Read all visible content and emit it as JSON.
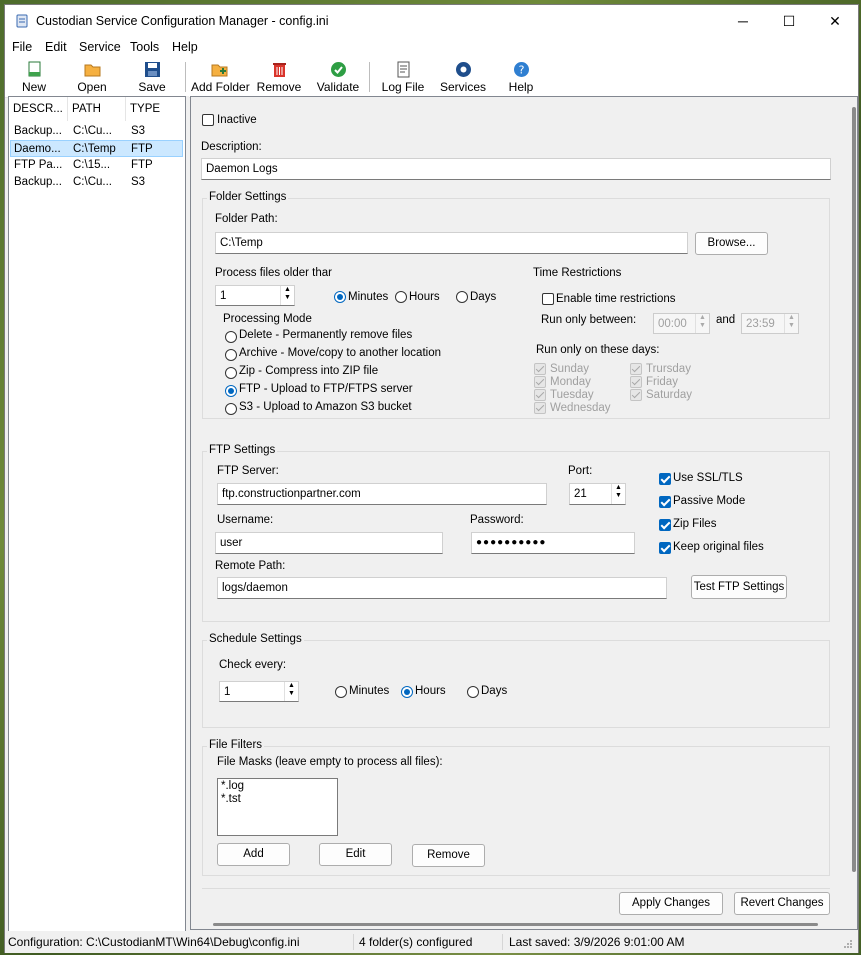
{
  "window": {
    "title": "Custodian Service Configuration Manager - config.ini",
    "minimize": "─",
    "maximize": "☐",
    "close": "✕"
  },
  "menu": [
    "File",
    "Edit",
    "Service",
    "Tools",
    "Help"
  ],
  "toolbar": {
    "new": "New",
    "open": "Open",
    "save": "Save",
    "add_folder": "Add Folder",
    "remove": "Remove",
    "validate": "Validate",
    "log_file": "Log File",
    "services": "Services",
    "help": "Help"
  },
  "folder_list": {
    "columns": [
      "DESCR...",
      "PATH",
      "TYPE"
    ],
    "rows": [
      {
        "desc": "Backup...",
        "path": "C:\\Cu...",
        "type": "S3"
      },
      {
        "desc": "Daemo...",
        "path": "C:\\Temp",
        "type": "FTP"
      },
      {
        "desc": "FTP Pa...",
        "path": "C:\\15...",
        "type": "FTP"
      },
      {
        "desc": "Backup...",
        "path": "C:\\Cu...",
        "type": "S3"
      }
    ]
  },
  "form": {
    "inactive_label": "Inactive",
    "description_label": "Description:",
    "description_value": "Daemon Logs",
    "folder_settings": {
      "title": "Folder Settings",
      "folder_path_label": "Folder Path:",
      "folder_path_value": "C:\\Temp",
      "browse": "Browse...",
      "older_than_label": "Process files older thar",
      "older_than_value": "1",
      "unit_minutes": "Minutes",
      "unit_hours": "Hours",
      "unit_days": "Days",
      "processing_mode_label": "Processing Mode",
      "modes": [
        "Delete - Permanently remove files",
        "Archive - Move/copy to another location",
        "Zip - Compress into ZIP file",
        "FTP - Upload to FTP/FTPS server",
        "S3 - Upload to Amazon S3 bucket"
      ],
      "time_restrictions_label": "Time Restrictions",
      "enable_time_label": "Enable time restrictions",
      "run_between_label": "Run only between:",
      "start_time": "00:00",
      "and_label": "and",
      "end_time": "23:59",
      "run_days_label": "Run only on these days:",
      "days_col1": [
        "Sunday",
        "Monday",
        "Tuesday",
        "Wednesday"
      ],
      "days_col2": [
        "Trursday",
        "Friday",
        "Saturday"
      ]
    },
    "ftp_settings": {
      "title": "FTP Settings",
      "server_label": "FTP Server:",
      "server_value": "ftp.constructionpartner.com",
      "port_label": "Port:",
      "port_value": "21",
      "ssl_label": "Use SSL/TLS",
      "passive_label": "Passive Mode",
      "zip_label": "Zip Files",
      "keep_label": "Keep original files",
      "username_label": "Username:",
      "username_value": "user",
      "password_label": "Password:",
      "password_value": "●●●●●●●●●●",
      "remote_path_label": "Remote Path:",
      "remote_path_value": "logs/daemon",
      "test_button": "Test FTP Settings"
    },
    "schedule": {
      "title": "Schedule Settings",
      "check_every_label": "Check every:",
      "check_every_value": "1",
      "unit_minutes": "Minutes",
      "unit_hours": "Hours",
      "unit_days": "Days"
    },
    "file_filters": {
      "title": "File Filters",
      "masks_label": "File Masks (leave empty to process all files):",
      "masks": [
        "*.log",
        "*.tst"
      ],
      "add": "Add",
      "edit": "Edit",
      "remove": "Remove"
    },
    "apply": "Apply Changes",
    "revert": "Revert Changes"
  },
  "status": {
    "config": "Configuration: C:\\CustodianMT\\Win64\\Debug\\config.ini",
    "count": "4 folder(s) configured",
    "saved": "Last saved: 3/9/2026 9:01:00 AM"
  },
  "colors": {
    "accent": "#0067c0",
    "selection": "#cce8ff"
  }
}
